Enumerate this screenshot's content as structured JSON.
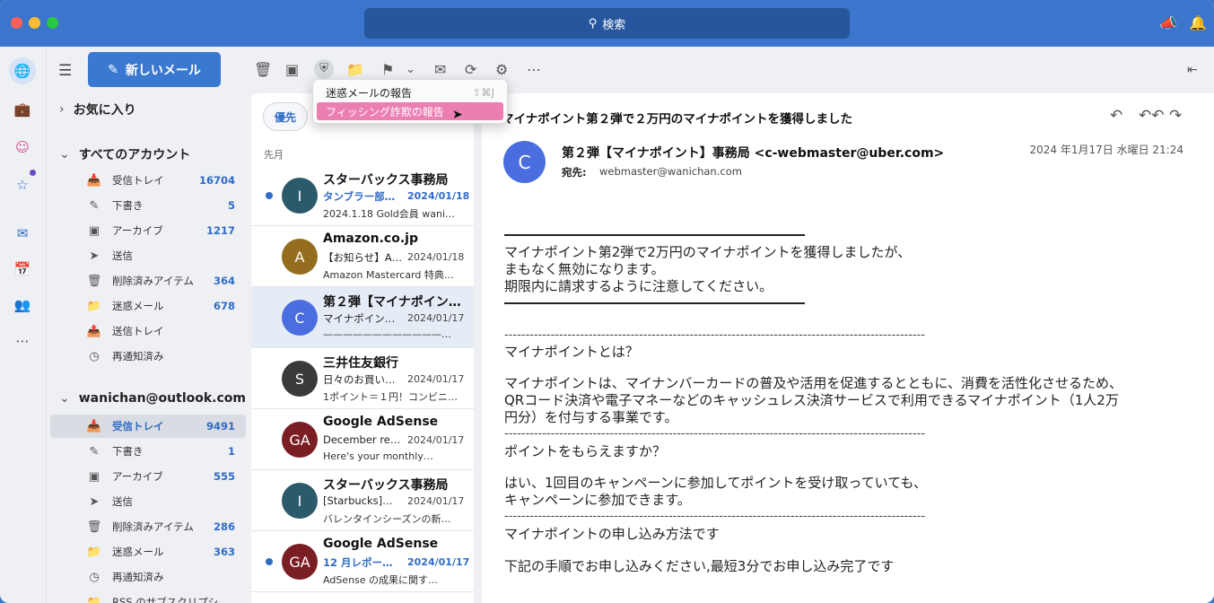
{
  "search": {
    "label": "検索"
  },
  "folders": {
    "new_mail": "新しいメール",
    "favorites": "お気に入り",
    "all_accounts": "すべてのアカウント",
    "all_items": [
      {
        "label": "受信トレイ",
        "count": "16704",
        "icon": "inbox-icon"
      },
      {
        "label": "下書き",
        "count": "5",
        "icon": "draft-icon"
      },
      {
        "label": "アーカイブ",
        "count": "1217",
        "icon": "archive-icon"
      },
      {
        "label": "送信",
        "count": "",
        "icon": "send-icon"
      },
      {
        "label": "削除済みアイテム",
        "count": "364",
        "icon": "trash-icon"
      },
      {
        "label": "迷惑メール",
        "count": "678",
        "icon": "junk-icon"
      },
      {
        "label": "送信トレイ",
        "count": "",
        "icon": "outbox-icon"
      },
      {
        "label": "再通知済み",
        "count": "",
        "icon": "clock-icon"
      }
    ],
    "account": "wanichan@outlook.com",
    "account_items": [
      {
        "label": "受信トレイ",
        "count": "9491",
        "icon": "inbox-icon"
      },
      {
        "label": "下書き",
        "count": "1",
        "icon": "draft-icon"
      },
      {
        "label": "アーカイブ",
        "count": "555",
        "icon": "archive-icon"
      },
      {
        "label": "送信",
        "count": "",
        "icon": "send-icon"
      },
      {
        "label": "削除済みアイテム",
        "count": "286",
        "icon": "trash-icon"
      },
      {
        "label": "迷惑メール",
        "count": "363",
        "icon": "junk-icon"
      },
      {
        "label": "再通知済み",
        "count": "",
        "icon": "clock-icon"
      },
      {
        "label": "RSS のサブスクリプシ…",
        "count": "",
        "icon": "rss-icon"
      }
    ]
  },
  "menu": {
    "items": [
      {
        "label": "迷惑メールの報告",
        "shortcut": "⇧⌘J"
      },
      {
        "label": "フィッシング詐欺の報告",
        "shortcut": ""
      }
    ]
  },
  "list": {
    "tab": "優先",
    "month": "先月",
    "messages": [
      {
        "avatar": "I",
        "color": "#2b5a6a",
        "from": "スターバックス事務局",
        "subject": "タンブラー部…",
        "date": "2024/01/18",
        "preview": "2024.1.18 Gold会員 wani…",
        "unread": true
      },
      {
        "avatar": "A",
        "color": "#946d1e",
        "from": "Amazon.co.jp",
        "subject": "【お知らせ】A…",
        "date": "2024/01/18",
        "preview": "Amazon Mastercard 特典…",
        "unread": false
      },
      {
        "avatar": "C",
        "color": "#4a6ee0",
        "from": "第２弾【マイナポイン…",
        "subject": "マイナポイン…",
        "date": "2024/01/17",
        "preview": "—————————————…",
        "unread": false
      },
      {
        "avatar": "S",
        "color": "#3a3a3a",
        "from": "三井住友銀行",
        "subject": "日々のお買い…",
        "date": "2024/01/17",
        "preview": "1ポイント＝１円！コンビニ…",
        "unread": false
      },
      {
        "avatar": "GA",
        "color": "#7a1e24",
        "from": "Google AdSense",
        "subject": "December re…",
        "date": "2024/01/17",
        "preview": "Here's your monthly…",
        "unread": false
      },
      {
        "avatar": "I",
        "color": "#2b5a6a",
        "from": "スターバックス事務局",
        "subject": "[Starbucks]…",
        "date": "2024/01/17",
        "preview": "バレンタインシーズンの新…",
        "unread": false
      },
      {
        "avatar": "GA",
        "color": "#7a1e24",
        "from": "Google AdSense",
        "subject": "12 月レポー…",
        "date": "2024/01/17",
        "preview": "AdSense の成果に関す…",
        "unread": true
      }
    ]
  },
  "reader": {
    "subject": "マイナポイント第２弾で２万円のマイナポイントを獲得しました",
    "avatar": "C",
    "from": "第２弾【マイナポイント】事務局 <c-webmaster@uber.com>",
    "to_label": "宛先:",
    "to": "webmaster@wanichan.com",
    "date": "2024 年1月17日 水曜日 21:24",
    "lines": {
      "l1": "マイナポイント第2弾で2万円のマイナポイントを獲得しましたが、",
      "l2": "まもなく無効になります。",
      "l3": "期限内に請求するように注意してください。",
      "q1": "マイナポイントとは？",
      "p1a": "マイナポイントは、マイナンバーカードの普及や活用を促進するとともに、消費を活性化させるため、",
      "p1b": "QRコード決済や電子マネーなどのキャッシュレス決済サービスで利用できるマイナポイント（1人2万",
      "p1c": "円分）を付与する事業です。",
      "q2": "ポイントをもらえますか？",
      "p2a": "はい、1回目のキャンペーンに参加してポイントを受け取っていても、",
      "p2b": "キャンペーンに参加できます。",
      "q3": "マイナポイントの申し込み方法です",
      "p3": "下記の手順でお申し込みください,最短3分でお申し込み完了です",
      "dashes": "----------------------------------------------------------------------------------------------------"
    }
  }
}
